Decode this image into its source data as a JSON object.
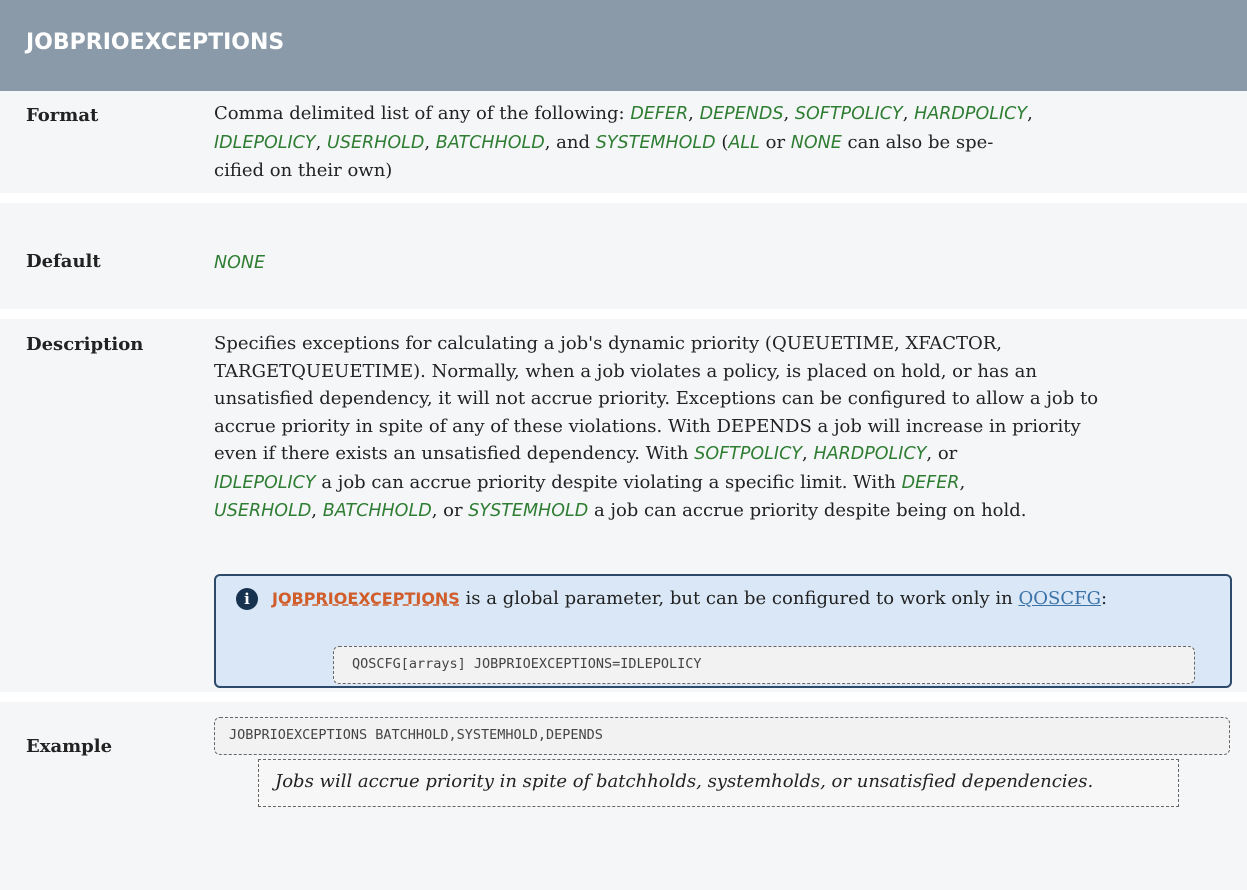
{
  "title": "JOBPRIOEXCEPTIONS",
  "rows": {
    "format": {
      "label": "Format",
      "line1": {
        "t0": "Comma delimited list of any of the following: ",
        "k1": "DEFER",
        "t1": ", ",
        "k2": "DEPENDS",
        "t2": ", ",
        "k3": "SOFTPOLICY",
        "t3": ", ",
        "k4": "HARDPOLICY",
        "t4": ","
      },
      "line2": {
        "k1": "IDLEPOLICY",
        "t1": ", ",
        "k2": "USERHOLD",
        "t2": ", ",
        "k3": "BATCHHOLD",
        "t3": ", and ",
        "k4": "SYSTEMHOLD",
        "t4": " (",
        "k5": "ALL",
        "t5": " or ",
        "k6": "NONE",
        "t6": " can also be spe-"
      },
      "line3": "cified on their own)"
    },
    "default": {
      "label": "Default",
      "value": "NONE"
    },
    "description": {
      "label": "Description",
      "line1": "Specifies exceptions for calculating a job's dynamic priority (QUEUETIME, XFACTOR,",
      "line2": "TARGETQUEUETIME). Normally, when a job violates a policy, is placed on hold, or has an",
      "line3": "unsatisfied dependency, it will not accrue priority. Exceptions can be configured to allow a job to",
      "line4": "accrue priority in spite of any of these violations. With DEPENDS a job will increase in priority",
      "line5": "even if there exists an unsatisfied dependency. With ",
      "line5_k1": "SOFTPOLICY",
      "line5_t1": ", ",
      "line5_k2": "HARDPOLICY",
      "line5_t2": ", or",
      "line6_k1": "IDLEPOLICY",
      "line6_t1": " a job can accrue priority despite violating a specific limit. With ",
      "line6_k2": "DEFER",
      "line6_t2": ",",
      "line7_k1": "USERHOLD",
      "line7_t1": ", ",
      "line7_k2": "BATCHHOLD",
      "line7_t2": ", or ",
      "line7_k3": "SYSTEMHOLD",
      "line7_t3": " a job can accrue priority despite being on hold.",
      "note": {
        "link": "JOBPRIOEXCEPTIONS",
        "text": " is a global parameter, but can be configured to work only in ",
        "link2": "QOSCFG",
        "text2": ":",
        "code": "QOSCFG[arrays]  JOBPRIOEXCEPTIONS=IDLEPOLICY"
      }
    },
    "example": {
      "label": "Example",
      "code": "JOBPRIOEXCEPTIONS BATCHHOLD,SYSTEMHOLD,DEPENDS",
      "caption": "Jobs will accrue priority in spite of batchholds, systemholds, or unsatisfied dependencies."
    }
  }
}
